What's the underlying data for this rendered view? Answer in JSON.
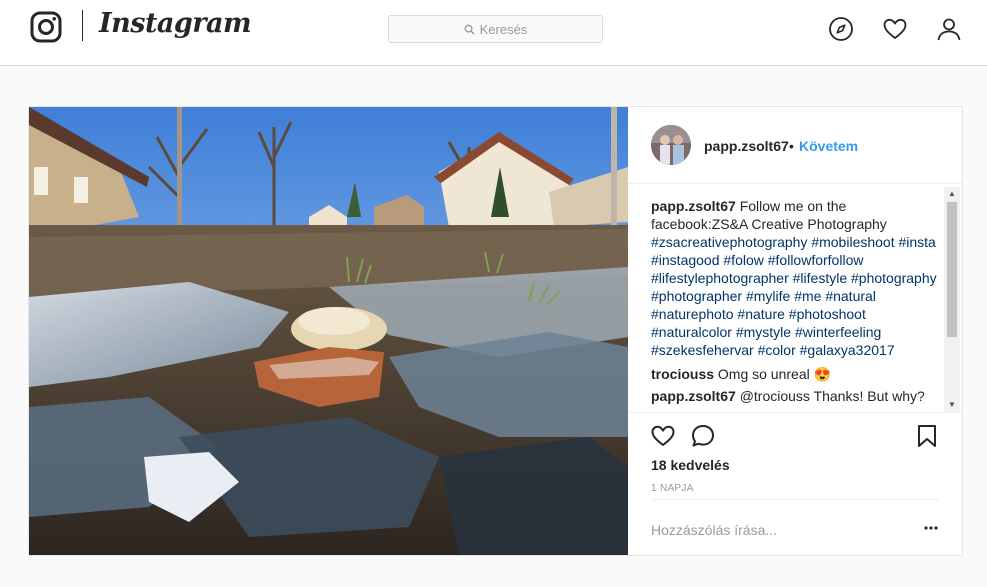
{
  "nav": {
    "logo_text": "Instagram",
    "logo_icon": "instagram-glyph-icon",
    "search_placeholder": "Keresés",
    "icons": [
      "compass-icon",
      "heart-icon",
      "profile-icon"
    ]
  },
  "post": {
    "username": "papp.zsolt67",
    "separator": "•",
    "follow_label": "Követem",
    "caption": {
      "user": "papp.zsolt67",
      "text": "Follow me on the facebook:ZS&A Creative Photography",
      "hashtags": "#zsacreativephotography #mobileshoot #insta #instagood #folow #followforfollow #lifestylephotographer #lifestyle #photography #photographer #mylife #me #natural #naturephoto #nature #photoshoot #naturalcolor #mystyle #winterfeeling #szekesfehervar #color #galaxya32017"
    },
    "comments": [
      {
        "user": "trociouss",
        "text": "Omg so unreal 😍"
      },
      {
        "user": "papp.zsolt67",
        "text": "@trociouss Thanks! But why?"
      }
    ],
    "likes_label": "18 kedvelés",
    "time_ago": "1 NAPJA",
    "add_comment_placeholder": "Hozzászólás írása...",
    "action_icons": [
      "like-heart-icon",
      "comment-bubble-icon",
      "bookmark-icon",
      "more-options-icon"
    ]
  },
  "colors": {
    "link_blue": "#3897f0",
    "hashtag_blue": "#003569",
    "text": "#262626",
    "muted": "#999999",
    "border": "#dbdbdb",
    "background": "#fafafa"
  }
}
